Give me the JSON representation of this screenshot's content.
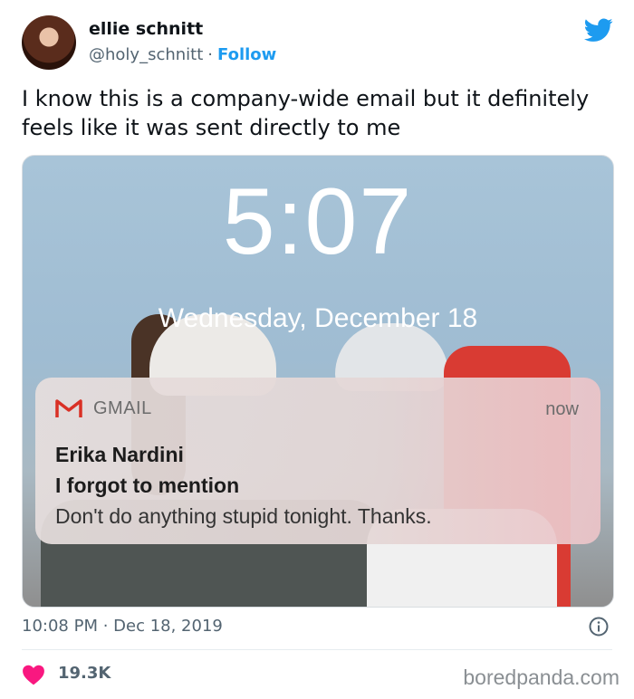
{
  "author": {
    "name": "ellie schnitt",
    "handle": "@holy_schnitt",
    "separator": "·",
    "follow_label": "Follow"
  },
  "tweet": {
    "text": "I know this is a company-wide email but it definitely feels like it was sent directly to me",
    "timestamp": "10:08 PM · Dec 18, 2019",
    "likes": "19.3K"
  },
  "lockscreen": {
    "time": "5:07",
    "date": "Wednesday, December 18",
    "notification": {
      "app": "GMAIL",
      "time": "now",
      "sender": "Erika Nardini",
      "subject": "I forgot to mention",
      "body": "Don't do anything stupid tonight. Thanks."
    }
  },
  "watermark": "boredpanda.com",
  "icons": {
    "brand": "twitter-bird-icon",
    "info": "info-icon",
    "like": "heart-icon",
    "app": "gmail-icon"
  },
  "colors": {
    "accent": "#1d9bf0",
    "like": "#f91880",
    "gmail_red": "#d93025"
  }
}
